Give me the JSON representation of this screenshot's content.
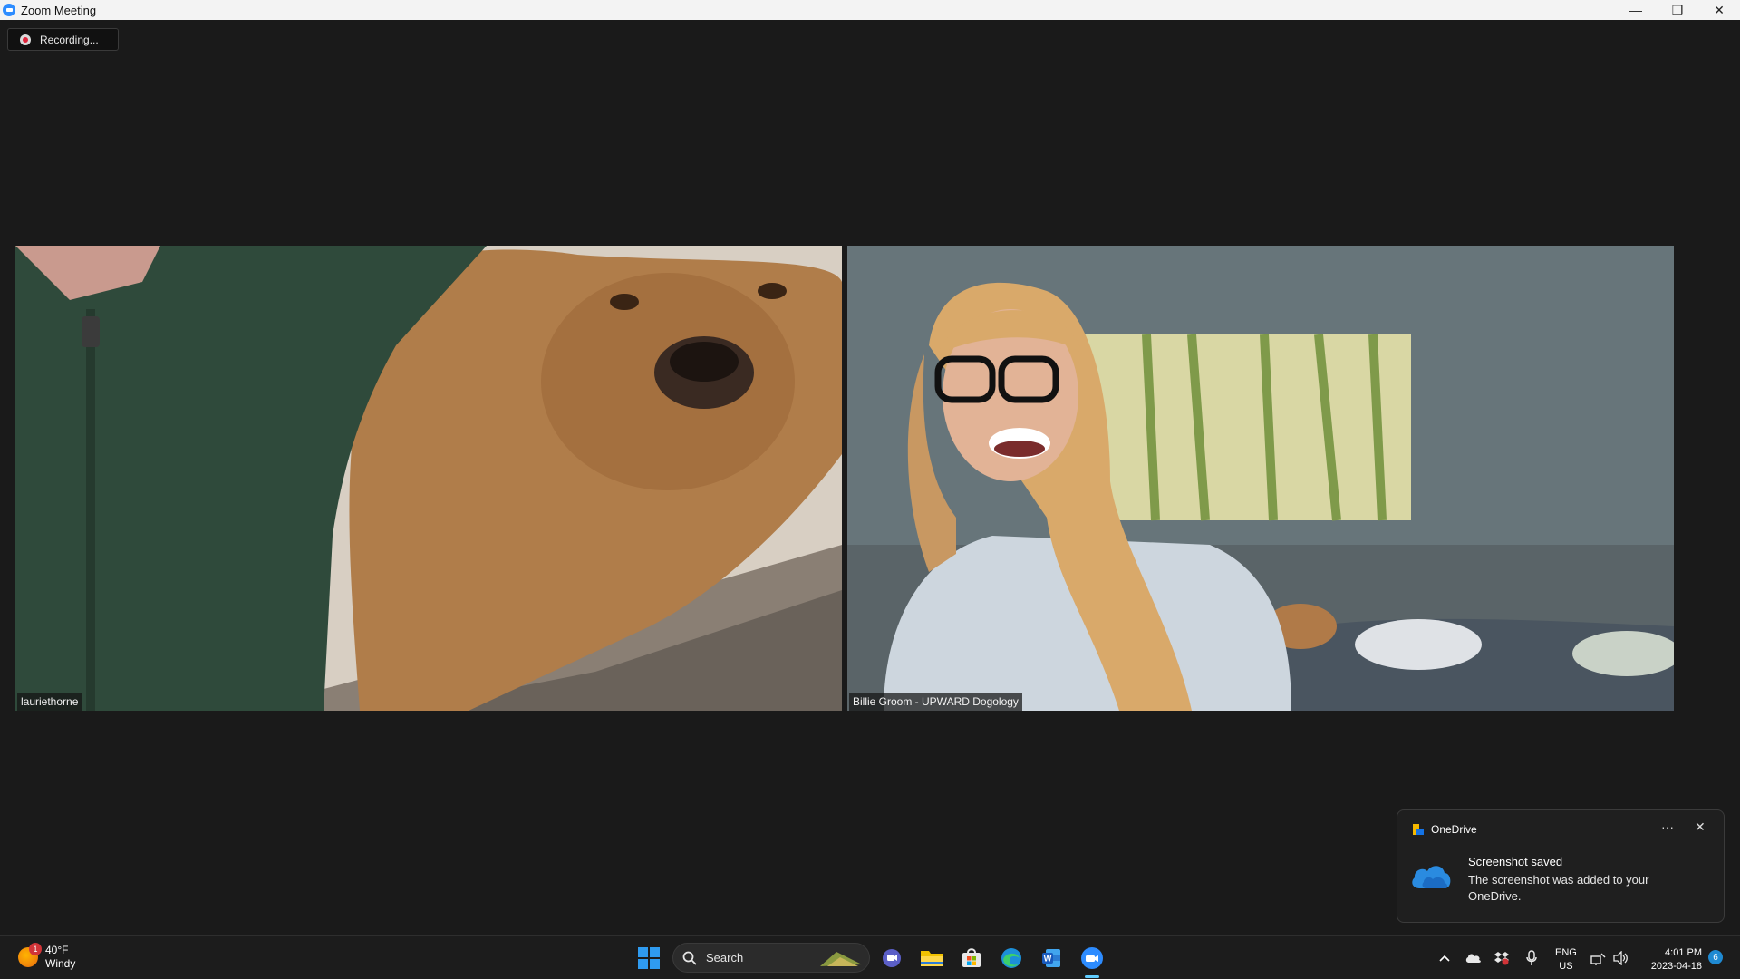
{
  "window": {
    "title": "Zoom Meeting",
    "controls": [
      "—",
      "❐",
      "✕"
    ]
  },
  "recording": {
    "label": "Recording..."
  },
  "participants": [
    {
      "name": "lauriethorne"
    },
    {
      "name": "Billie Groom - UPWARD Dogology"
    }
  ],
  "notification": {
    "app": "OneDrive",
    "more": "···",
    "close": "✕",
    "title": "Screenshot saved",
    "body": "The screenshot was added to your OneDrive."
  },
  "taskbar": {
    "weather": {
      "badge": "1",
      "temp": "40°F",
      "condition": "Windy"
    },
    "search_label": "Search",
    "apps": [
      "start-icon",
      "search",
      "teams-chat-icon",
      "file-explorer-icon",
      "microsoft-store-icon",
      "edge-icon",
      "word-icon",
      "zoom-icon"
    ],
    "tray": {
      "lang_line1": "ENG",
      "lang_line2": "US",
      "time": "4:01 PM",
      "date": "2023-04-18",
      "notif_count": "6"
    }
  }
}
